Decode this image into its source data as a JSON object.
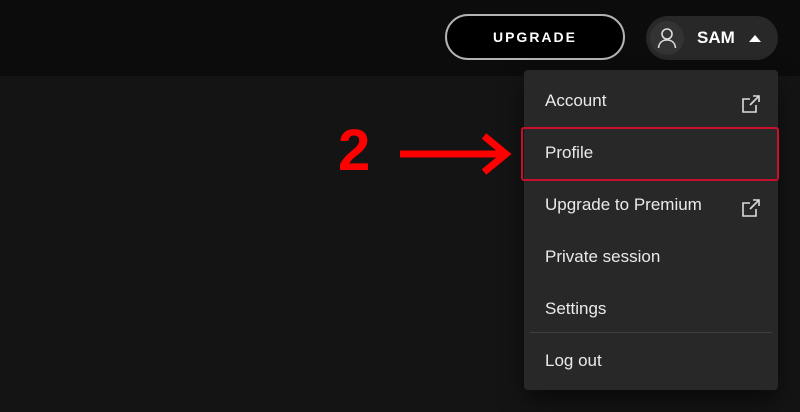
{
  "header": {
    "upgrade_label": "UPGRADE",
    "user_name": "SAM"
  },
  "menu": {
    "items": [
      {
        "label": "Account",
        "icon": "external-link-icon"
      },
      {
        "label": "Profile"
      },
      {
        "label": "Upgrade to Premium",
        "icon": "external-link-icon"
      },
      {
        "label": "Private session"
      },
      {
        "label": "Settings"
      },
      {
        "label": "Log out"
      }
    ]
  },
  "annotation": {
    "step_number": "2",
    "color": "#ff0000",
    "highlighted_item": "Profile"
  },
  "colors": {
    "background": "#121212",
    "menu_background": "#282828",
    "highlight": "#c8102e"
  }
}
